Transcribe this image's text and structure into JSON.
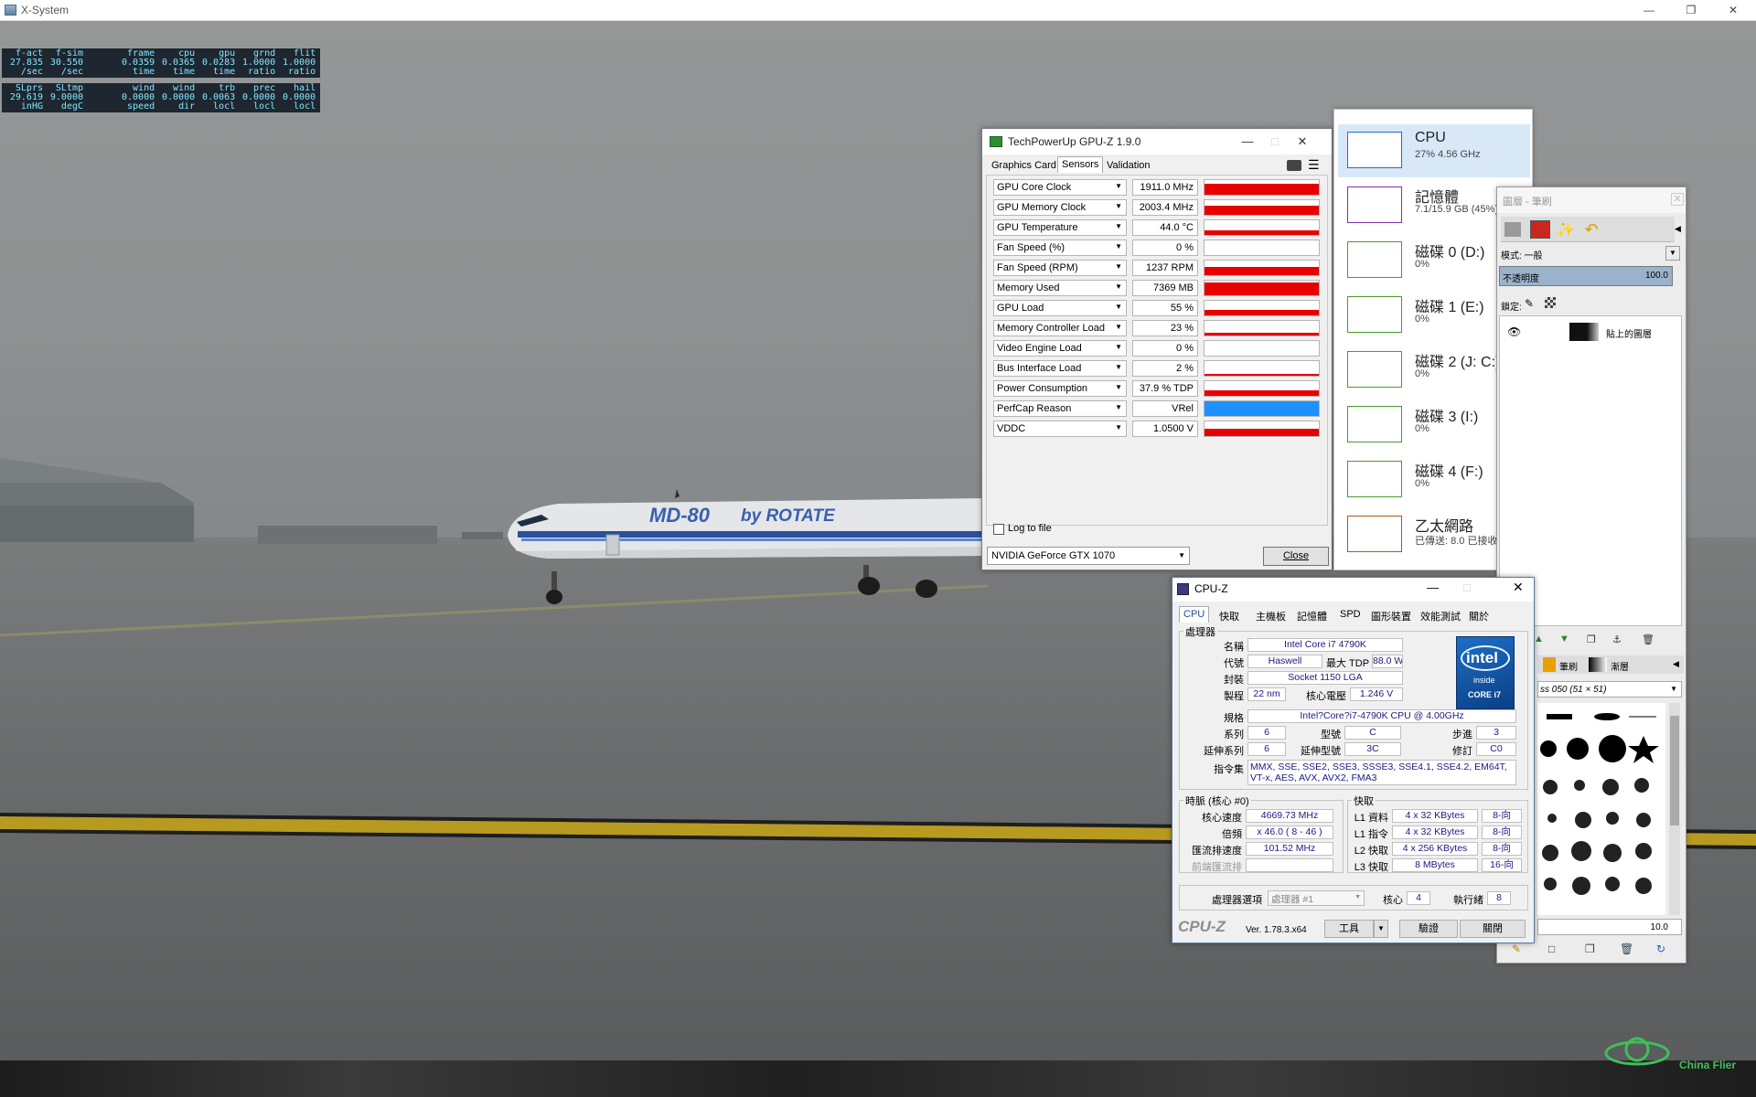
{
  "window": {
    "title": "X-System"
  },
  "dataout": {
    "row1": {
      "headers": [
        "f-act",
        "f-sim",
        "frame",
        "cpu",
        "gpu",
        "grnd",
        "flit"
      ],
      "values": [
        "27.835",
        "30.550",
        "0.0359",
        "0.0365",
        "0.0283",
        "1.0000",
        "1.0000"
      ],
      "units": [
        "/sec",
        "/sec",
        "time",
        "time",
        "time",
        "ratio",
        "ratio"
      ]
    },
    "row2": {
      "headers": [
        "SLprs",
        "SLtmp",
        "wind",
        "wind",
        "trb",
        "prec",
        "hail"
      ],
      "values": [
        "29.619",
        "9.0000",
        "0.0000",
        "0.0000",
        "0.0063",
        "0.0000",
        "0.0000"
      ],
      "units": [
        "inHG",
        "degC",
        "speed",
        "dir",
        "locl",
        "locl",
        "locl"
      ]
    }
  },
  "gpuz": {
    "title": "TechPowerUp GPU-Z 1.9.0",
    "tabs": [
      "Graphics Card",
      "Sensors",
      "Validation"
    ],
    "sensors": [
      {
        "name": "GPU Core Clock",
        "value": "1911.0 MHz",
        "level": 0.75
      },
      {
        "name": "GPU Memory Clock",
        "value": "2003.4 MHz",
        "level": 0.6
      },
      {
        "name": "GPU Temperature",
        "value": "44.0 °C",
        "level": 0.3
      },
      {
        "name": "Fan Speed (%)",
        "value": "0 %",
        "level": 0.0
      },
      {
        "name": "Fan Speed (RPM)",
        "value": "1237 RPM",
        "level": 0.55
      },
      {
        "name": "Memory Used",
        "value": "7369 MB",
        "level": 0.85
      },
      {
        "name": "GPU Load",
        "value": "55 %",
        "level": 0.35
      },
      {
        "name": "Memory Controller Load",
        "value": "23 %",
        "level": 0.18
      },
      {
        "name": "Video Engine Load",
        "value": "0 %",
        "level": 0.0
      },
      {
        "name": "Bus Interface Load",
        "value": "2 %",
        "level": 0.05
      },
      {
        "name": "Power Consumption",
        "value": "37.9 % TDP",
        "level": 0.4
      },
      {
        "name": "PerfCap Reason",
        "value": "VRel",
        "level": 1.0
      },
      {
        "name": "VDDC",
        "value": "1.0500 V",
        "level": 0.5
      }
    ],
    "log_to_file": "Log to file",
    "gpu_select": "NVIDIA GeForce GTX 1070",
    "close_label": "Close",
    "colors": {
      "graph": "#e80000",
      "perfcap": "#1e90ff"
    }
  },
  "taskmgr": {
    "items": [
      {
        "label": "CPU",
        "sub": "27% 4.56 GHz",
        "color": "#1c73c6"
      },
      {
        "label": "記憶體",
        "sub": "7.1/15.9 GB (45%)",
        "color": "#8b2fa6"
      },
      {
        "label": "磁碟 0 (D:)",
        "sub": "0%",
        "color": "#4a9b2f"
      },
      {
        "label": "磁碟 1 (E:)",
        "sub": "0%",
        "color": "#4a9b2f"
      },
      {
        "label": "磁碟 2 (J: C:)",
        "sub": "0%",
        "color": "#4a9b2f"
      },
      {
        "label": "磁碟 3 (I:)",
        "sub": "0%",
        "color": "#4a9b2f"
      },
      {
        "label": "磁碟 4 (F:)",
        "sub": "0%",
        "color": "#4a9b2f"
      },
      {
        "label": "乙太網路",
        "sub": "已傳送: 8.0 已接收",
        "color": "#a85a1c"
      }
    ]
  },
  "gimp": {
    "title": "圖層 - 筆刷",
    "mode_label": "模式:",
    "mode_value": "一般",
    "opacity_label": "不透明度",
    "opacity_value": "100.0",
    "lock_label": "鎖定:",
    "layer_name": "貼上的圖層",
    "brushes_tab": "筆刷",
    "gradients_tab": "漸層",
    "brush_name": "ss 050 (51 × 51)",
    "spacing_value": "10.0"
  },
  "cpuz": {
    "title": "CPU-Z",
    "tabs": [
      "CPU",
      "快取",
      "主機板",
      "記憶體",
      "SPD",
      "圖形裝置",
      "效能測試",
      "關於"
    ],
    "processor_group": "處理器",
    "name_label": "名稱",
    "name": "Intel Core i7 4790K",
    "codename_label": "代號",
    "codename": "Haswell",
    "tdp_label": "最大 TDP",
    "tdp": "88.0 W",
    "package_label": "封裝",
    "package": "Socket 1150 LGA",
    "tech_label": "製程",
    "tech": "22 nm",
    "voltage_label": "核心電壓",
    "voltage": "1.246 V",
    "spec_label": "規格",
    "spec": "Intel?Core?i7-4790K CPU @ 4.00GHz",
    "family_label": "系列",
    "family": "6",
    "model_label": "型號",
    "model": "C",
    "stepping_label": "步進",
    "stepping": "3",
    "extfamily_label": "延伸系列",
    "extfamily": "6",
    "extmodel_label": "延伸型號",
    "extmodel": "3C",
    "revision_label": "修訂",
    "revision": "C0",
    "instr_label": "指令集",
    "instr": "MMX, SSE, SSE2, SSE3, SSSE3, SSE4.1, SSE4.2, EM64T, VT-x, AES, AVX, AVX2, FMA3",
    "clocks_group": "時脈 (核心 #0)",
    "corespeed_label": "核心速度",
    "corespeed": "4669.73 MHz",
    "mult_label": "倍頻",
    "mult": "x 46.0 ( 8 - 46 )",
    "bus_label": "匯流排速度",
    "bus": "101.52 MHz",
    "fsb_label": "前端匯流排",
    "fsb": "",
    "cache_group": "快取",
    "l1d_label": "L1 資料",
    "l1d": "4 x 32 KBytes",
    "l1d_way": "8-向",
    "l1i_label": "L1 指令",
    "l1i": "4 x 32 KBytes",
    "l1i_way": "8-向",
    "l2_label": "L2 快取",
    "l2": "4 x 256 KBytes",
    "l2_way": "8-向",
    "l3_label": "L3 快取",
    "l3": "8 MBytes",
    "l3_way": "16-向",
    "sel_label": "處理器選項",
    "sel": "處理器 #1",
    "cores_label": "核心",
    "cores": "4",
    "threads_label": "執行緒",
    "threads": "8",
    "brand": "CPU-Z",
    "version": "Ver. 1.78.3.x64",
    "tools_label": "工具",
    "validate_label": "驗證",
    "close_label": "關閉",
    "intel_logo": {
      "word": "intel",
      "inside": "inside",
      "line": "CORE i7"
    }
  },
  "watermark": {
    "text": "China Flier"
  }
}
